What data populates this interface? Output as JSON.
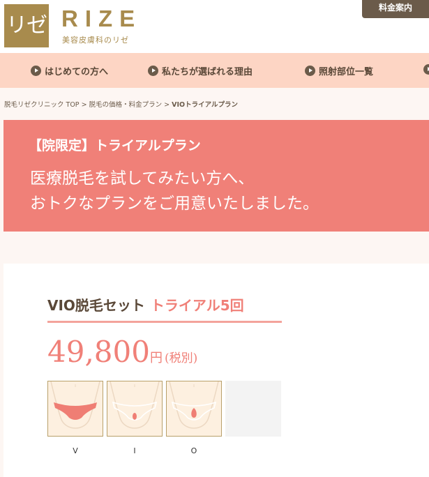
{
  "header": {
    "logo_mark": "リゼ",
    "logo_word": "RIZE",
    "logo_sub": "美容皮膚科のリゼ",
    "price_button": "料金案内"
  },
  "nav": {
    "items": [
      {
        "label": "はじめての方へ"
      },
      {
        "label": "私たちが選ばれる理由"
      },
      {
        "label": "照射部位一覧"
      }
    ]
  },
  "breadcrumb": {
    "items": [
      "脱毛リゼクリニック TOP",
      "脱毛の価格・料金プラン"
    ],
    "separator": ">",
    "current": "VIOトライアルプラン"
  },
  "hero": {
    "label": "【院限定】トライアルプラン",
    "line1": "医療脱毛を試してみたい方へ、",
    "line2": "おトクなプランをご用意いたしました。"
  },
  "plan": {
    "title": "VIO脱毛セット",
    "accent": "トライアル5回",
    "price": "49,800",
    "unit": "円",
    "tax": "(税別)",
    "areas": [
      "V",
      "I",
      "O"
    ]
  },
  "colors": {
    "gold": "#a88b4d",
    "coral": "#f08078",
    "nav_bg": "#fdd5c4",
    "dark_brown": "#6b5b4a"
  }
}
